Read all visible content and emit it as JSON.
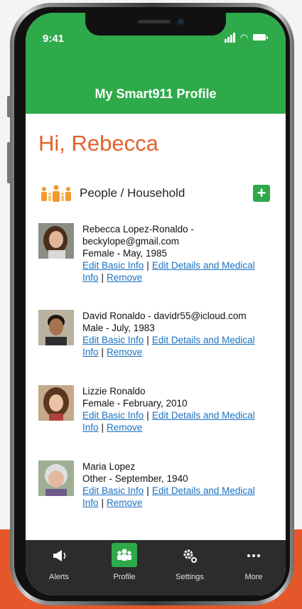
{
  "status": {
    "time": "9:41"
  },
  "header": {
    "title": "My Smart911 Profile"
  },
  "greeting": "Hi, Rebecca",
  "section": {
    "title": "People / Household",
    "add_label": "+"
  },
  "people": [
    {
      "line1": "Rebecca Lopez-Ronaldo -",
      "line2": "beckylope@gmail.com",
      "line3": "Female - May, 1985",
      "edit_basic": "Edit Basic Info",
      "edit_details": "Edit Details and Medical Info",
      "remove": "Remove",
      "sep": "|"
    },
    {
      "line1": "David Ronaldo - davidr55@icloud.com",
      "line2": "Male - July, 1983",
      "edit_basic": "Edit Basic Info",
      "edit_details": "Edit Details and Medical Info",
      "remove": "Remove",
      "sep": "|"
    },
    {
      "line1": "Lizzie Ronaldo",
      "line2": "Female - February, 2010",
      "edit_basic": "Edit Basic Info",
      "edit_details": "Edit Details and Medical Info",
      "remove": "Remove",
      "sep": "|"
    },
    {
      "line1": "Maria Lopez",
      "line2": "Other - September, 1940",
      "edit_basic": "Edit Basic Info",
      "edit_details": "Edit Details and Medical Info",
      "remove": "Remove",
      "sep": "|"
    }
  ],
  "nav": [
    {
      "label": "Alerts",
      "icon": "megaphone-icon"
    },
    {
      "label": "Profile",
      "icon": "people-icon"
    },
    {
      "label": "Settings",
      "icon": "gear-icon"
    },
    {
      "label": "More",
      "icon": "more-dots-icon"
    }
  ],
  "colors": {
    "brand_green": "#2faa4a",
    "accent_orange": "#e4622a",
    "link_blue": "#1b72c0"
  }
}
